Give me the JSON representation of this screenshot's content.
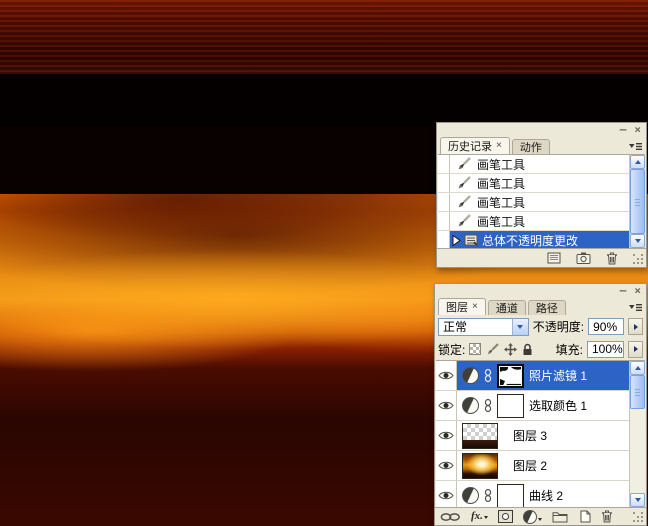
{
  "colors": {
    "selection_blue": "#2e63c6",
    "panel_chrome": "#ece9d8",
    "scroll_accent": "#2b5cab"
  },
  "history_panel": {
    "window": {
      "minimize_label": "–",
      "close_label": "×"
    },
    "tabs": [
      {
        "label": "历史记录",
        "close_glyph": "×"
      },
      {
        "label": "动作"
      }
    ],
    "rows": [
      {
        "icon": "brush-icon",
        "label": "画笔工具"
      },
      {
        "icon": "brush-icon",
        "label": "画笔工具"
      },
      {
        "icon": "brush-icon",
        "label": "画笔工具"
      },
      {
        "icon": "brush-icon",
        "label": "画笔工具"
      },
      {
        "icon": "history-state-icon",
        "label": "总体不透明度更改",
        "selected": true
      }
    ],
    "footer_icons": [
      "new-document-from-state-icon",
      "new-snapshot-icon",
      "delete-icon"
    ]
  },
  "layers_panel": {
    "window": {
      "minimize_label": "–",
      "close_label": "×"
    },
    "tabs": [
      {
        "label": "图层",
        "close_glyph": "×"
      },
      {
        "label": "通道"
      },
      {
        "label": "路径"
      }
    ],
    "blend_mode_value": "正常",
    "opacity_label": "不透明度:",
    "opacity_value": "90%",
    "lock_label": "锁定:",
    "lock_icons": [
      "lock-transparency-icon",
      "lock-image-icon",
      "lock-position-icon",
      "lock-all-icon"
    ],
    "fill_label": "填充:",
    "fill_value": "100%",
    "layers": [
      {
        "name": "照片滤镜 1",
        "type": "adjustment-with-mask",
        "selected": true
      },
      {
        "name": "选取颜色 1",
        "type": "adjustment-with-mask"
      },
      {
        "name": "图层 3",
        "type": "image"
      },
      {
        "name": "图层 2",
        "type": "image"
      },
      {
        "name": "曲线 2",
        "type": "adjustment-with-mask"
      }
    ],
    "footer": {
      "layer_style_label": "fx.",
      "icons": [
        "link-layers-icon",
        "layer-style-icon",
        "add-mask-icon",
        "new-adjustment-icon",
        "new-group-icon",
        "new-layer-icon",
        "delete-layer-icon"
      ]
    }
  }
}
